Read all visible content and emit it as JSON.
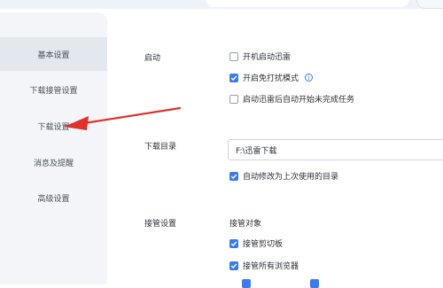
{
  "colors": {
    "accent": "#3a7bf1",
    "arrow": "#e0312a",
    "sidebar_bg": "#f3f5f8",
    "sidebar_active": "#e3e8ef"
  },
  "sidebar": {
    "items": [
      {
        "label": "基本设置",
        "active": true
      },
      {
        "label": "下载接管设置",
        "active": false
      },
      {
        "label": "下载设置",
        "active": false
      },
      {
        "label": "消息及提醒",
        "active": false
      },
      {
        "label": "高级设置",
        "active": false
      }
    ]
  },
  "startup": {
    "section_label": "启动",
    "options": [
      {
        "label": "开机启动迅雷",
        "checked": false
      },
      {
        "label": "开启免打扰模式",
        "checked": true,
        "icon": "info-icon"
      },
      {
        "label": "启动迅雷后自动开始未完成任务",
        "checked": false
      }
    ]
  },
  "download_dir": {
    "section_label": "下载目录",
    "path_value": "F:\\迅雷下载",
    "auto_modify": {
      "label": "自动修改为上次使用的目录",
      "checked": true
    }
  },
  "takeover": {
    "section_label": "接管设置",
    "subheading": "接管对象",
    "options": [
      {
        "label": "接管剪切板",
        "checked": true
      },
      {
        "label": "接管所有浏览器",
        "checked": true
      }
    ]
  }
}
